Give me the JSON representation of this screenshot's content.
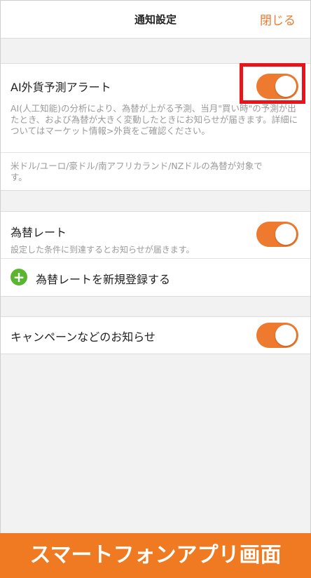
{
  "header": {
    "title": "通知設定",
    "close_label": "閉じる"
  },
  "ai_alert": {
    "label": "AI外貨予測アラート",
    "description": "AI(人工知能)の分析により、為替が上がる予測、当月\"買い時\"の予測が出たとき、および為替が大きく変動したときにお知らせが届きます。詳細についてはマーケット情報>外貨をご確認ください。",
    "currencies_note": "米ドル/ユーロ/豪ドル/南アフリカランド/NZドルの為替が対象です。",
    "toggle_on": true
  },
  "fx_rate": {
    "label": "為替レート",
    "description": "設定した条件に到達するとお知らせが届きます。",
    "toggle_on": true,
    "add_label": "為替レートを新規登録する"
  },
  "campaign": {
    "label": "キャンペーンなどのお知らせ",
    "toggle_on": true
  },
  "banner": {
    "text": "スマートフォンアプリ画面"
  },
  "colors": {
    "accent": "#ee7a2f",
    "highlight": "#e8141b",
    "add_green": "#5cb531",
    "banner": "#ef7a22"
  }
}
